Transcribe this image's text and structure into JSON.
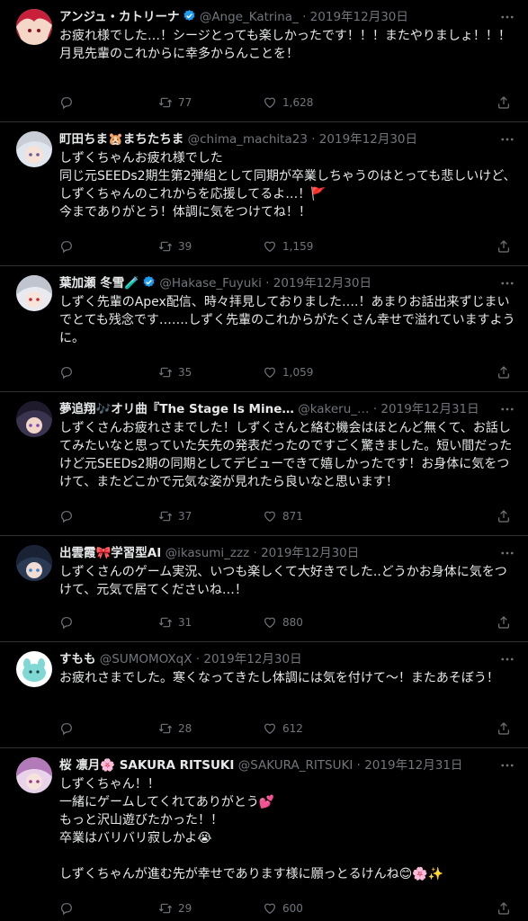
{
  "icons": {
    "reply": "reply-icon",
    "retweet": "retweet-icon",
    "like": "heart-icon",
    "share": "share-icon",
    "more": "more-icon",
    "verified": "verified-badge-icon"
  },
  "colors": {
    "background": "#000000",
    "text": "#e7e9ea",
    "secondary": "#71767b",
    "border": "#2f3336",
    "verified": "#1d9bf0"
  },
  "tweets": [
    {
      "name": "アンジュ・カトリーナ",
      "verified": true,
      "handle": "@Ange_Katrina_",
      "date": "2019年12月30日",
      "text": "お疲れ様でした…！シージとっても楽しかったです！！！またやりましょ！！！\n月見先輩のこれからに幸多からんことを！",
      "retweets": "77",
      "likes": "1,628"
    },
    {
      "name": "町田ちま🐹まちたちま",
      "verified": false,
      "handle": "@chima_machita23",
      "date": "2019年12月30日",
      "text": "しずくちゃんお疲れ様でした\n同じ元SEEDs2期生第2弾組として同期が卒業しちゃうのはとっても悲しいけど、しずくちゃんのこれからを応援してるよ…！🚩\n今までありがとう！体調に気をつけてね！！",
      "retweets": "39",
      "likes": "1,159"
    },
    {
      "name": "葉加瀬 冬雪🧪",
      "verified": true,
      "handle": "@Hakase_Fuyuki",
      "date": "2019年12月30日",
      "text": "しずく先輩のApex配信、時々拝見しておりました….！あまりお話出来ずじまいでとても残念です…….しずく先輩のこれからがたくさん幸せで溢れていますように。",
      "retweets": "35",
      "likes": "1,059"
    },
    {
      "name": "夢追翔🎶オリ曲『The Stage Is Mine…",
      "verified": false,
      "handle": "@kakeru_…",
      "date": "2019年12月31日",
      "text": "しずくさんお疲れさまでした！しずくさんと絡む機会はほとんど無くて、お話してみたいなと思っていた矢先の発表だったのですごく驚きました。短い間だったけど元SEEDs2期の同期としてデビューできて嬉しかったです！お身体に気をつけて、またどこかで元気な姿が見れたら良いなと思います！",
      "retweets": "37",
      "likes": "871"
    },
    {
      "name": "出雲霞🎀学習型AI",
      "verified": false,
      "handle": "@ikasumi_zzz",
      "date": "2019年12月30日",
      "text": "しずくさんのゲーム実況、いつも楽しくて大好きでした..どうかお身体に気をつけて、元気で居てくださいね…！",
      "retweets": "31",
      "likes": "880"
    },
    {
      "name": "すもも",
      "verified": false,
      "handle": "@SUMOMOXqX",
      "date": "2019年12月30日",
      "text": "お疲れさまでした。寒くなってきたし体調には気を付けて〜！またあそぼう！",
      "retweets": "28",
      "likes": "612"
    },
    {
      "name": "桜 凛月🌸 SAKURA RITSUKI",
      "verified": false,
      "handle": "@SAKURA_RITSUKI",
      "date": "2019年12月31日",
      "text": "しずくちゃん！！\n一緒にゲームしてくれてありがとう💕\nもっと沢山遊びたかった！！\n卒業はバリバリ寂しかよ😭\n\nしずくちゃんが進む先が幸せであります様に願っとるけんね😊🌸✨",
      "retweets": "29",
      "likes": "600"
    }
  ]
}
